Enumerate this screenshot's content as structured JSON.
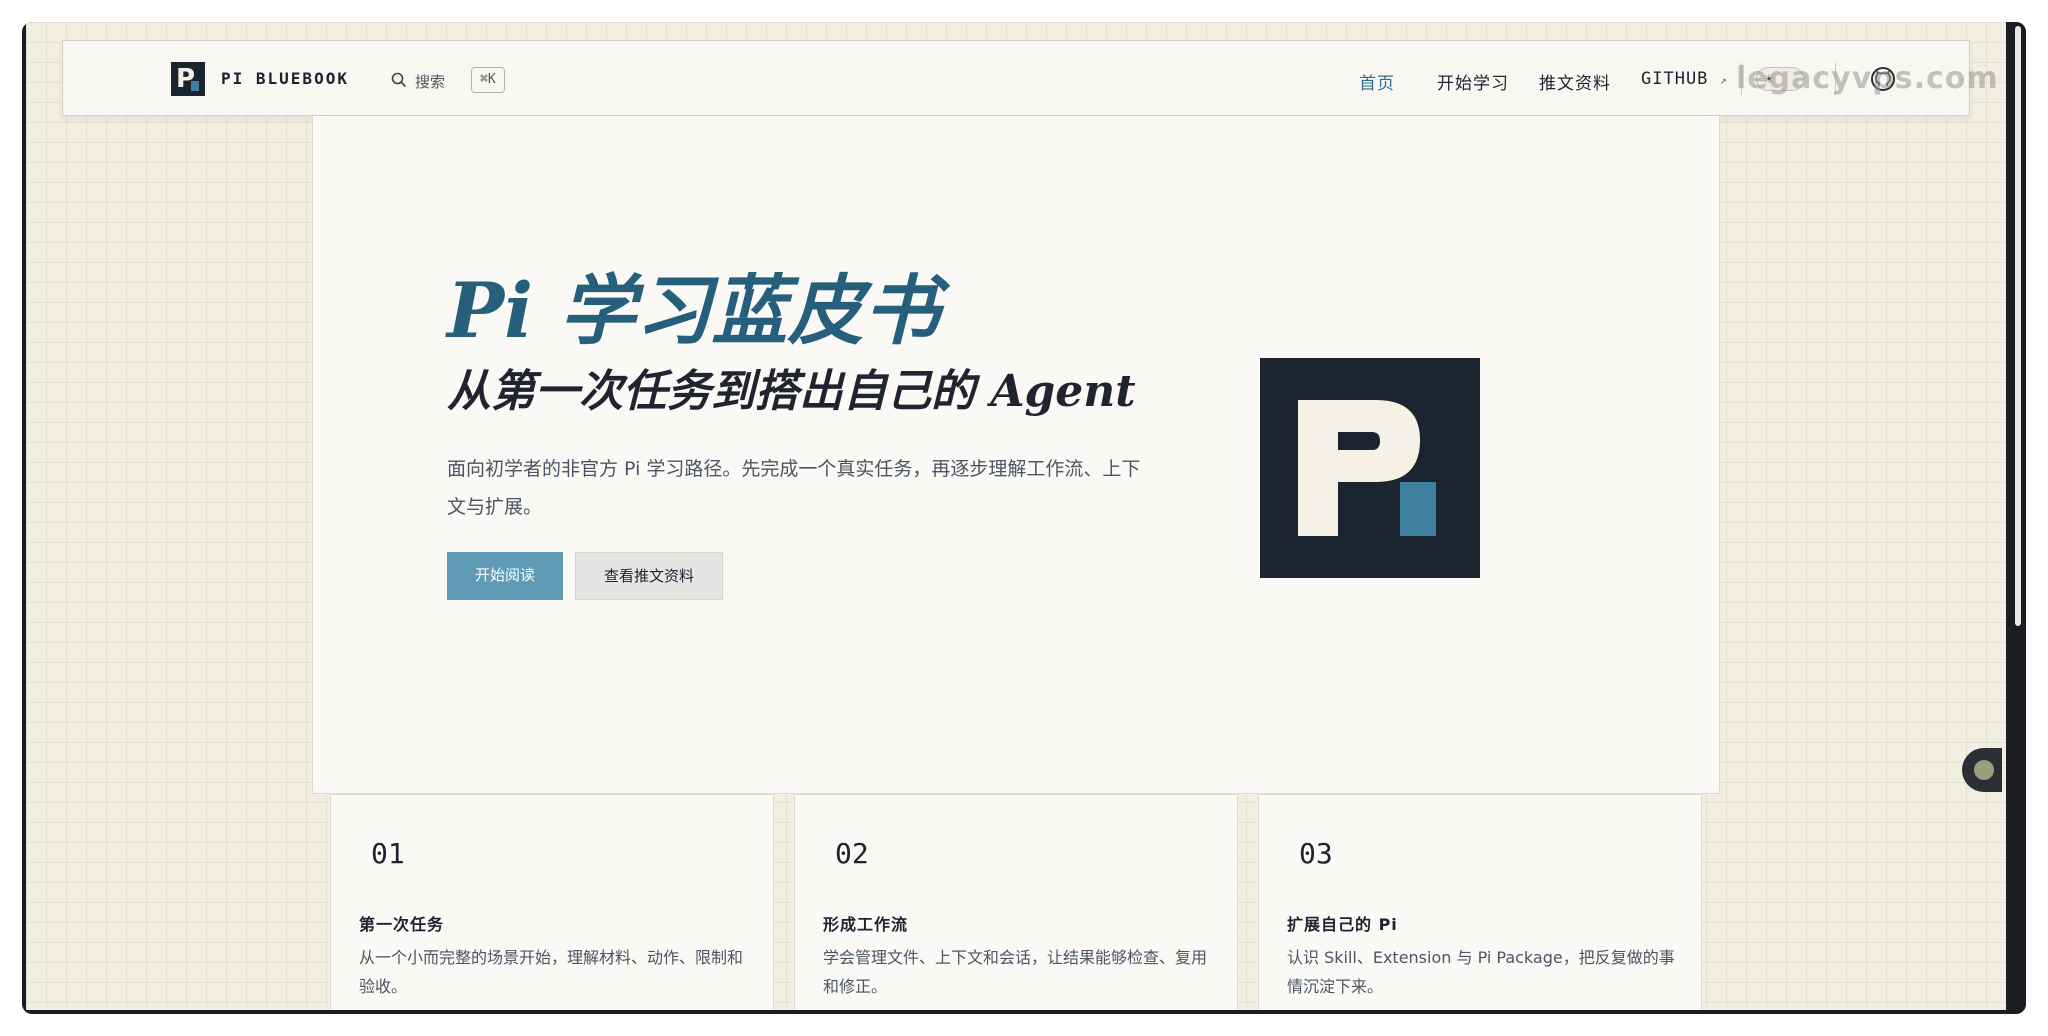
{
  "header": {
    "brand": "PI BLUEBOOK",
    "search_label": "搜索",
    "search_shortcut": "⌘K",
    "nav": [
      {
        "label": "首页",
        "active": true
      },
      {
        "label": "开始学习",
        "active": false
      },
      {
        "label": "推文资料",
        "active": false
      },
      {
        "label": "GITHUB",
        "active": false
      }
    ],
    "github_ext_arrow": "↗",
    "watermark": "legacyvps.com"
  },
  "hero": {
    "title": "Pi 学习蓝皮书",
    "subtitle": "从第一次任务到搭出自己的 Agent",
    "description": "面向初学者的非官方 Pi 学习路径。先完成一个真实任务，再逐步理解工作流、上下文与扩展。",
    "primary_button": "开始阅读",
    "secondary_button": "查看推文资料"
  },
  "cards": [
    {
      "num": "01",
      "title": "第一次任务",
      "desc": "从一个小而完整的场景开始，理解材料、动作、限制和验收。"
    },
    {
      "num": "02",
      "title": "形成工作流",
      "desc": "学会管理文件、上下文和会话，让结果能够检查、复用和修正。"
    },
    {
      "num": "03",
      "title": "扩展自己的 Pi",
      "desc": "认识 Skill、Extension 与 Pi Package，把反复做的事情沉淀下来。"
    }
  ],
  "colors": {
    "accent": "#2c6f8e",
    "logo_dark": "#1b2530",
    "logo_square": "#3f7f9f",
    "button_primary": "#5f9bb5"
  }
}
